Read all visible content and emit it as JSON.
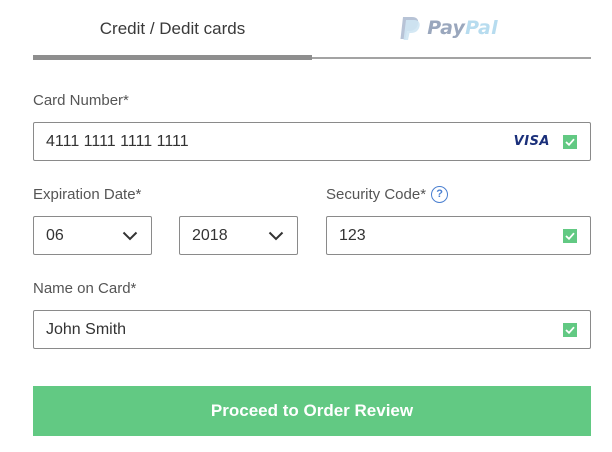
{
  "tabs": {
    "card_label": "Credit / Dedit cards",
    "paypal_text_pay": "Pay",
    "paypal_text_pal": "Pal"
  },
  "card_number": {
    "label": "Card Number*",
    "value": "4111 1111 1111 1111",
    "brand": "VISA",
    "valid": true
  },
  "expiration": {
    "label": "Expiration Date*",
    "month": "06",
    "year": "2018"
  },
  "security_code": {
    "label": "Security Code*",
    "help": "?",
    "value": "123",
    "valid": true
  },
  "name_on_card": {
    "label": "Name on Card*",
    "value": "John Smith",
    "valid": true
  },
  "submit": {
    "label": "Proceed to Order Review"
  },
  "colors": {
    "accent_green": "#62c983",
    "tab_underline": "#8e8e8e",
    "visa_blue": "#1a2f7a",
    "help_blue": "#4a7fd0"
  },
  "icons": {
    "check": "check-icon",
    "chevron": "chevron-down-icon",
    "paypal": "paypal-logo",
    "help": "help-icon"
  }
}
